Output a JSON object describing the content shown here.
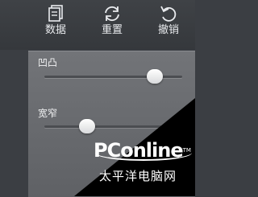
{
  "toolbar": {
    "data_label": "数据",
    "reset_label": "重置",
    "undo_label": "撤销"
  },
  "sliders": {
    "bump": {
      "label": "凹凸",
      "value": 0.8
    },
    "width": {
      "label": "宽窄",
      "value": 0.31
    }
  },
  "watermark": {
    "brand": "PConline",
    "mark": "TM",
    "subtitle": "太平洋电脑网"
  },
  "colors": {
    "toolbar_bg": "#3b3e43",
    "panel_bg": "#6b6d71",
    "thumb": "#f4f4f5",
    "watermark_bg": "#000000"
  },
  "icons": [
    "document-stack-icon",
    "reset-arrows-icon",
    "undo-arrow-icon"
  ]
}
